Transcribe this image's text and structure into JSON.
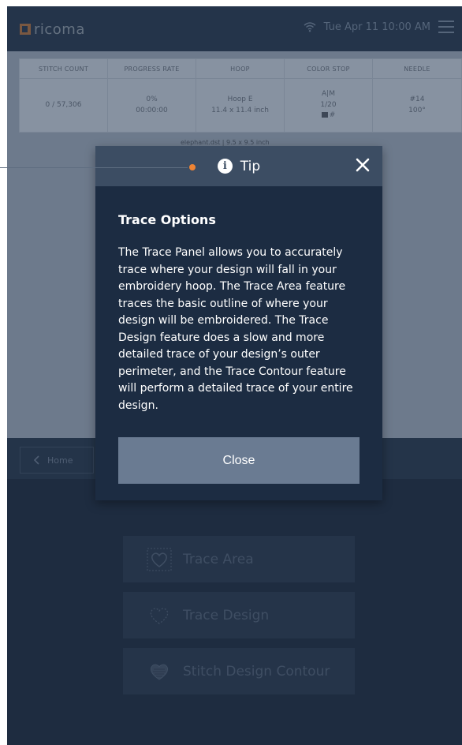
{
  "header": {
    "logo_text": "ricoma",
    "datetime": "Tue Apr 11  10:00 AM",
    "icons": [
      "wifi-icon",
      "menu-icon"
    ]
  },
  "stats": {
    "columns": [
      {
        "label": "STITCH COUNT",
        "lines": [
          "0 / 57,306"
        ]
      },
      {
        "label": "PROGRESS RATE",
        "lines": [
          "0%",
          "00:00:00"
        ]
      },
      {
        "label": "HOOP",
        "lines": [
          "Hoop E",
          "11.4 x 11.4 inch"
        ]
      },
      {
        "label": "COLOR STOP",
        "lines": [
          "A|M",
          "1/20",
          "#"
        ]
      },
      {
        "label": "NEEDLE",
        "lines": [
          "#14",
          "100°"
        ]
      }
    ]
  },
  "filename": "elephant.dst  |  9.5 x 9.5 inch",
  "nav": {
    "home_label": "Home"
  },
  "actions": [
    {
      "label": "Trace Area",
      "icon": "heart-dashed-box-icon"
    },
    {
      "label": "Trace Design",
      "icon": "heart-outline-icon"
    },
    {
      "label": "Stitch Design Contour",
      "icon": "heart-filled-icon"
    }
  ],
  "modal": {
    "header_label": "Tip",
    "title": "Trace Options",
    "body": "The Trace Panel allows you to accurately trace where your design will fall in your embroidery hoop. The Trace Area feature traces the basic outline of where your design will be embroidered. The Trace Design feature does a slow and more detailed trace of your design’s outer perimeter, and the Trace Contour feature will perform a detailed trace of your entire design.",
    "close_button": "Close"
  },
  "colors": {
    "accent_dot": "#ef8434",
    "modal_bg": "#1c2c42",
    "modal_header": "#3c4d63",
    "close_button_bg": "#6a7b92"
  }
}
